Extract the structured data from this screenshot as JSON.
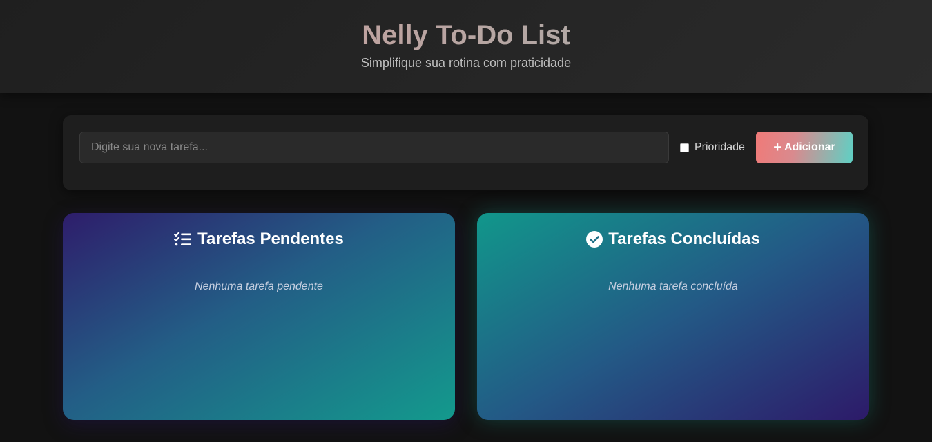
{
  "header": {
    "title": "Nelly To-Do List",
    "subtitle": "Simplifique sua rotina com praticidade"
  },
  "form": {
    "placeholder": "Digite sua nova tarefa...",
    "value": "",
    "priority_label": "Prioridade",
    "priority_checked": false,
    "add_label": "Adicionar",
    "add_icon": "plus-icon"
  },
  "pending": {
    "title": "Tarefas Pendentes",
    "icon": "list-check-icon",
    "empty_text": "Nenhuma tarefa pendente"
  },
  "done": {
    "title": "Tarefas Concluídas",
    "icon": "circle-check-icon",
    "empty_text": "Nenhuma tarefa concluída"
  },
  "colors": {
    "background": "#121212",
    "accent_coral": "#f07a78",
    "accent_teal": "#5fd0c4",
    "panel_purple": "#2e1d6b",
    "panel_teal": "#139a8d"
  }
}
